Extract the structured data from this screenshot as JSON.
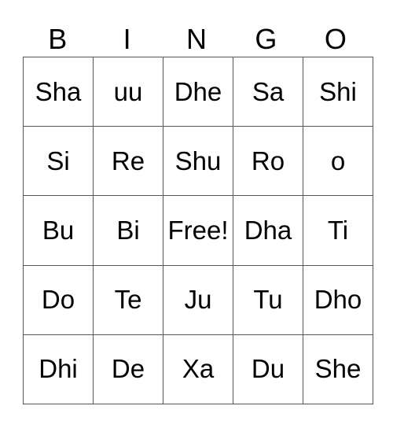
{
  "header": [
    "B",
    "I",
    "N",
    "G",
    "O"
  ],
  "rows": [
    [
      "Sha",
      "uu",
      "Dhe",
      "Sa",
      "Shi"
    ],
    [
      "Si",
      "Re",
      "Shu",
      "Ro",
      "o"
    ],
    [
      "Bu",
      "Bi",
      "Free!",
      "Dha",
      "Ti"
    ],
    [
      "Do",
      "Te",
      "Ju",
      "Tu",
      "Dho"
    ],
    [
      "Dhi",
      "De",
      "Xa",
      "Du",
      "She"
    ]
  ]
}
